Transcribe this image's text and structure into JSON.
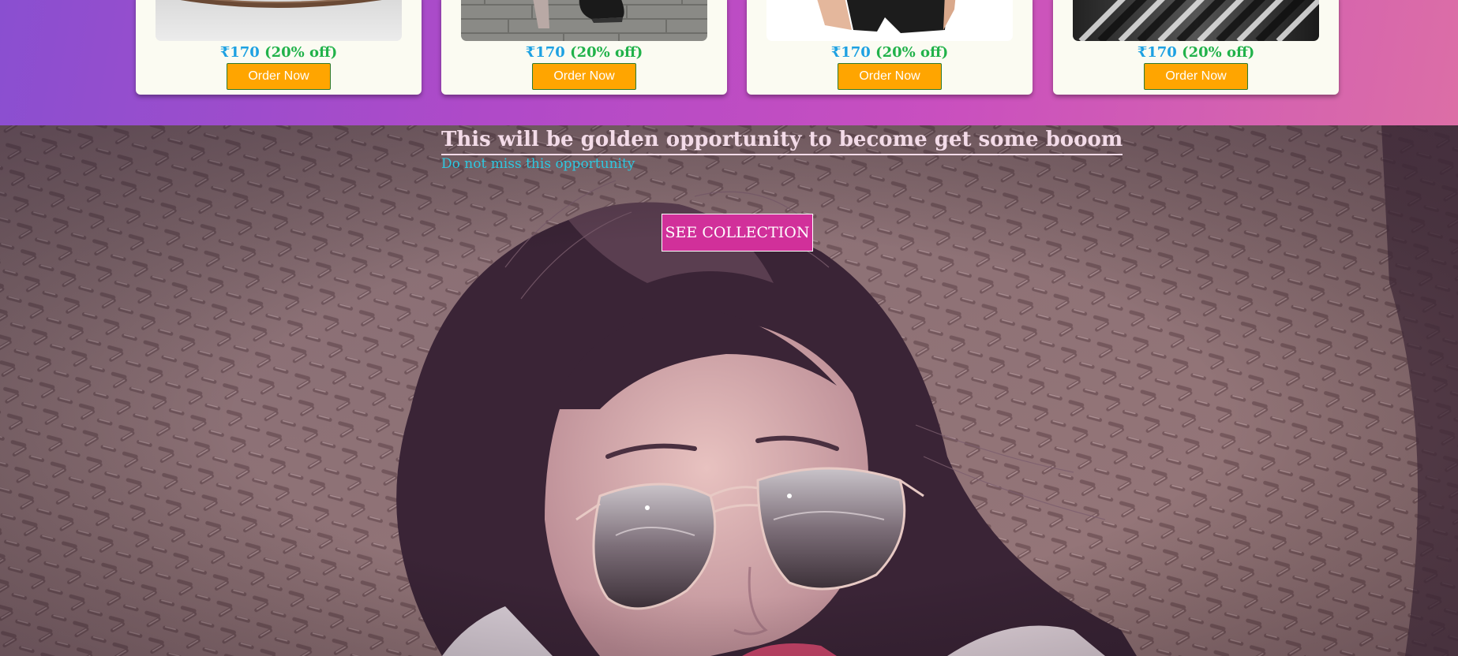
{
  "products": [
    {
      "amount": "₹170",
      "discount": "(20% off)",
      "button": "Order Now",
      "image": "brown-belt-photo"
    },
    {
      "amount": "₹170",
      "discount": "(20% off)",
      "button": "Order Now",
      "image": "heels-on-pavement-photo"
    },
    {
      "amount": "₹170",
      "discount": "(20% off)",
      "button": "Order Now",
      "image": "black-shorts-photo"
    },
    {
      "amount": "₹170",
      "discount": "(20% off)",
      "button": "Order Now",
      "image": "metal-bars-photo"
    }
  ],
  "hero": {
    "title": "This will be golden opportunity to become get some booom",
    "subtitle": "Do not miss this opportunity",
    "cta": "SEE COLLECTION",
    "image": "woman-aviator-sunglasses-photo"
  },
  "colors": {
    "strip_gradient": [
      "#8a4fd0",
      "#c94fbf",
      "#dc6ea6"
    ],
    "card_bg": "#fbfbf2",
    "price": "#1da1e2",
    "discount": "#21b24a",
    "order_button": "#ffa500",
    "cta_button": "#d1309a",
    "subtitle": "#2ec8e0"
  }
}
